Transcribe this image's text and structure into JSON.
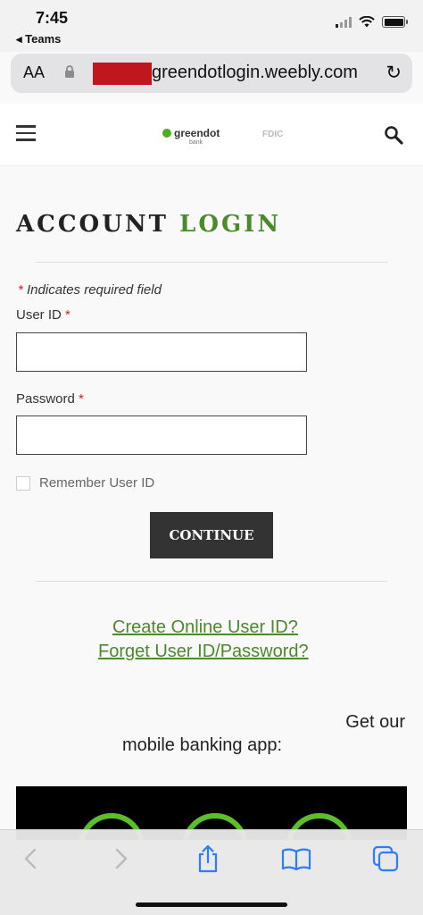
{
  "status": {
    "time": "7:45",
    "back_app": "◂ Teams"
  },
  "browser": {
    "aa": "AA",
    "url": "greendotlogin.weebly.com"
  },
  "header": {
    "logo_text": "greendot",
    "logo_sub": "bank",
    "fdic": "FDIC"
  },
  "page": {
    "title_dark": "ACCOUNT ",
    "title_green": "LOGIN",
    "required_note": "Indicates required field",
    "required_mark": "*",
    "user_id_label": "User ID",
    "password_label": "Password",
    "remember_label": "Remember User ID",
    "continue_label": "CONTINUE",
    "create_link": "Create Online User ID?",
    "forget_link": "Forget User ID/Password?",
    "get_app_1": "Get our",
    "get_app_2": "mobile banking app:"
  },
  "colors": {
    "brand_green": "#4a8a2a",
    "required_red": "#d62222",
    "ios_blue": "#2f7cf6"
  }
}
